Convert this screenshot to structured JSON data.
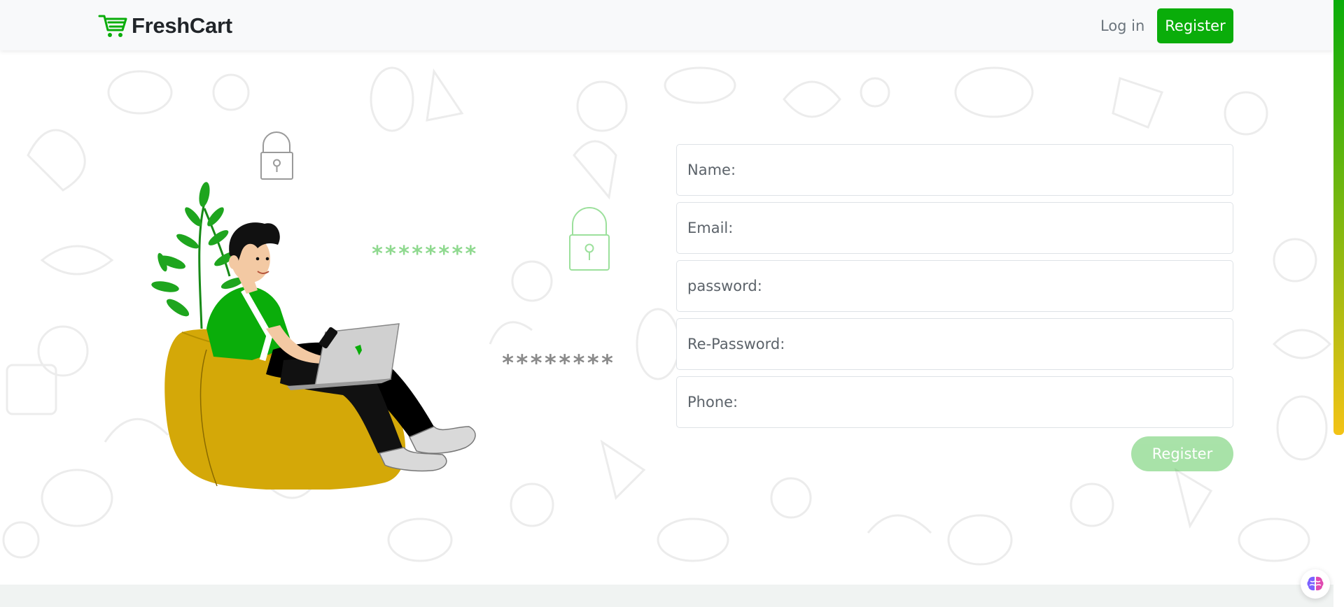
{
  "navbar": {
    "brand": "FreshCart",
    "brand_icon": "shopping-cart-icon",
    "login_label": "Log in",
    "register_label": "Register"
  },
  "illustration": {
    "stars_green": "********",
    "stars_grey": "********"
  },
  "form": {
    "name_placeholder": "Name:",
    "email_placeholder": "Email:",
    "password_placeholder": "password:",
    "repassword_placeholder": "Re-Password:",
    "phone_placeholder": "Phone:",
    "submit_label": "Register",
    "submit_disabled": true
  },
  "floating_button": {
    "icon": "brain-icon"
  },
  "colors": {
    "brand_green": "#0aad0a",
    "cushion": "#d4a808",
    "scroll_gradient_end": "#f3c316"
  }
}
